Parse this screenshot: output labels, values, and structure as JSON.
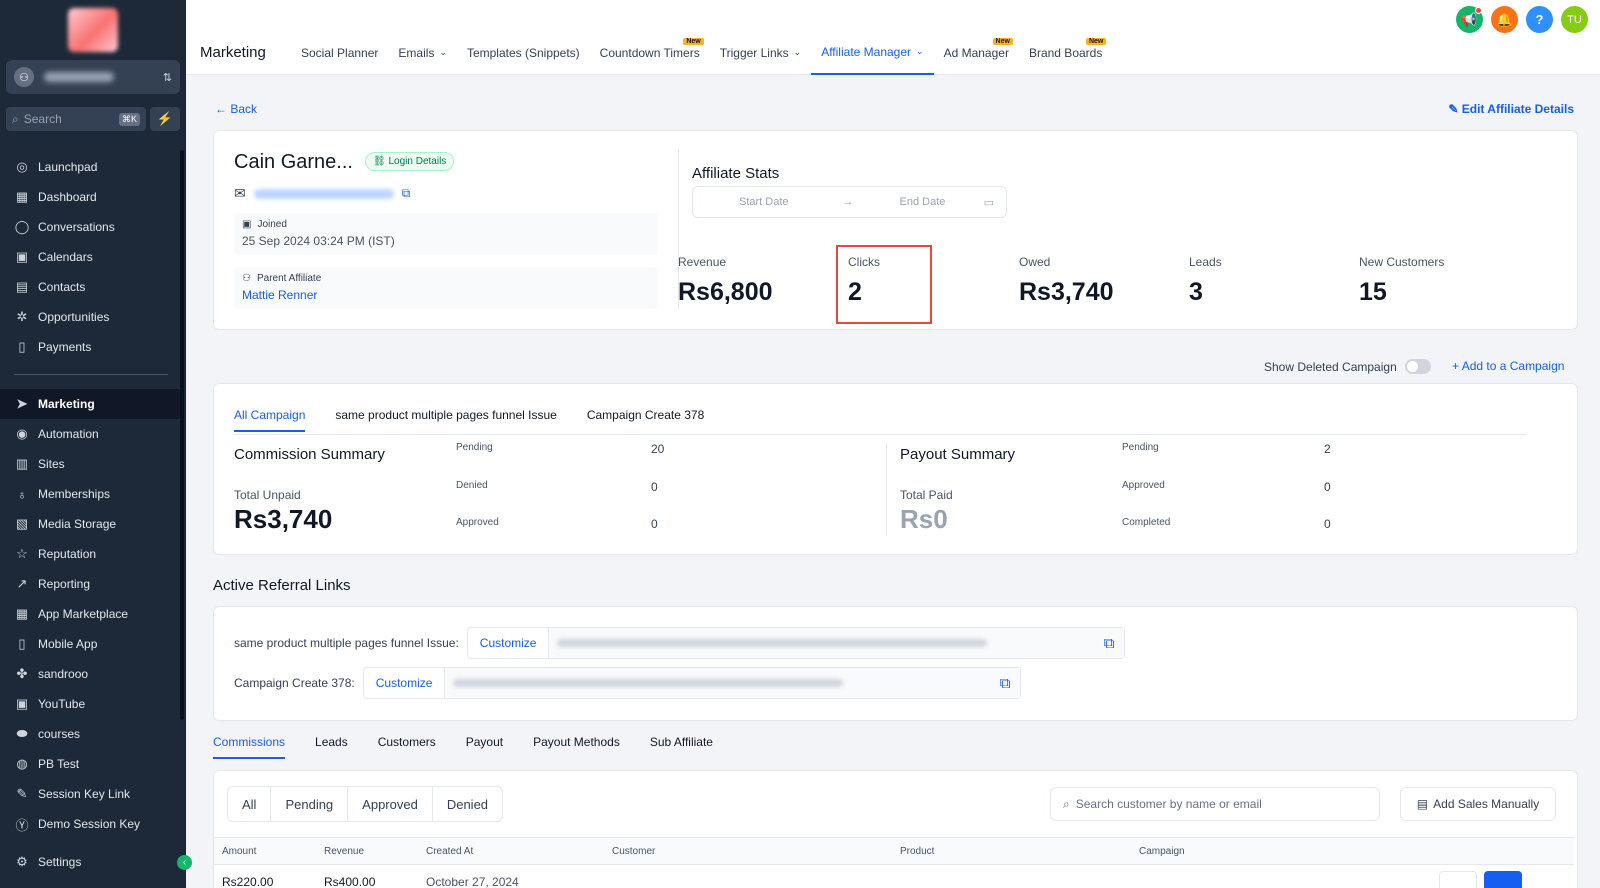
{
  "sidebar": {
    "search_placeholder": "Search",
    "search_shortcut": "⌘K",
    "items": [
      {
        "label": "Launchpad",
        "icon": "rocket-icon",
        "glyph": "◎"
      },
      {
        "label": "Dashboard",
        "icon": "dashboard-icon",
        "glyph": "▦"
      },
      {
        "label": "Conversations",
        "icon": "chat-icon",
        "glyph": "◯"
      },
      {
        "label": "Calendars",
        "icon": "calendar-icon",
        "glyph": "▣"
      },
      {
        "label": "Contacts",
        "icon": "contacts-icon",
        "glyph": "▤"
      },
      {
        "label": "Opportunities",
        "icon": "opportunities-icon",
        "glyph": "✲"
      },
      {
        "label": "Payments",
        "icon": "payments-icon",
        "glyph": "▯"
      }
    ],
    "items2": [
      {
        "label": "Marketing",
        "icon": "send-icon",
        "glyph": "➤",
        "active": true
      },
      {
        "label": "Automation",
        "icon": "automation-icon",
        "glyph": "◉"
      },
      {
        "label": "Sites",
        "icon": "sites-icon",
        "glyph": "▥"
      },
      {
        "label": "Memberships",
        "icon": "memberships-icon",
        "glyph": "♁"
      },
      {
        "label": "Media Storage",
        "icon": "media-icon",
        "glyph": "▧"
      },
      {
        "label": "Reputation",
        "icon": "star-icon",
        "glyph": "☆"
      },
      {
        "label": "Reporting",
        "icon": "reporting-icon",
        "glyph": "↗"
      },
      {
        "label": "App Marketplace",
        "icon": "marketplace-icon",
        "glyph": "▦"
      },
      {
        "label": "Mobile App",
        "icon": "mobile-icon",
        "glyph": "▯"
      },
      {
        "label": "sandrooo",
        "icon": "link-icon",
        "glyph": "✤"
      },
      {
        "label": "YouTube",
        "icon": "youtube-icon",
        "glyph": "▣"
      },
      {
        "label": "courses",
        "icon": "courses-icon",
        "glyph": "⬬"
      },
      {
        "label": "PB Test",
        "icon": "pbtest-icon",
        "glyph": "◍"
      },
      {
        "label": "Session Key Link",
        "icon": "wrench-icon",
        "glyph": "✎"
      },
      {
        "label": "Demo Session Key",
        "icon": "yahoo-icon",
        "glyph": "Ⓨ"
      }
    ],
    "settings": {
      "label": "Settings",
      "icon": "gear-icon",
      "glyph": "⚙"
    }
  },
  "header": {
    "title": "Marketing",
    "tabs": [
      {
        "label": "Social Planner"
      },
      {
        "label": "Emails",
        "dropdown": true
      },
      {
        "label": "Templates (Snippets)"
      },
      {
        "label": "Countdown Timers",
        "badge": "New"
      },
      {
        "label": "Trigger Links",
        "dropdown": true
      },
      {
        "label": "Affiliate Manager",
        "dropdown": true,
        "active": true
      },
      {
        "label": "Ad Manager",
        "badge": "New"
      },
      {
        "label": "Brand Boards",
        "badge": "New"
      }
    ],
    "avatar": "TU",
    "colors": {
      "megaphone": "#12b76a",
      "bell": "#f97316",
      "help": "#2e90fa",
      "avatar": "#84cc16"
    }
  },
  "back_label": "Back",
  "edit_label": "Edit Affiliate Details",
  "affiliate": {
    "name": "Cain Garne...",
    "login_label": "Login Details",
    "joined_label": "Joined",
    "joined_value": "25 Sep 2024 03:24 PM (IST)",
    "parent_label": "Parent Affiliate",
    "parent_value": "Mattie Renner"
  },
  "stats": {
    "title": "Affiliate Stats",
    "start_placeholder": "Start Date",
    "end_placeholder": "End Date",
    "items": [
      {
        "label": "Revenue",
        "value": "Rs6,800"
      },
      {
        "label": "Clicks",
        "value": "2"
      },
      {
        "label": "Owed",
        "value": "Rs3,740"
      },
      {
        "label": "Leads",
        "value": "3"
      },
      {
        "label": "New Customers",
        "value": "15"
      }
    ]
  },
  "show_deleted_label": "Show Deleted Campaign",
  "add_campaign_label": "Add to a Campaign",
  "campaign_tabs": [
    "All Campaign",
    "same product multiple pages funnel Issue",
    "Campaign Create 378"
  ],
  "commission": {
    "title": "Commission Summary",
    "total_label": "Total Unpaid",
    "total_value": "Rs3,740",
    "rows": [
      {
        "label": "Pending",
        "value": "20"
      },
      {
        "label": "Denied",
        "value": "0"
      },
      {
        "label": "Approved",
        "value": "0"
      }
    ]
  },
  "payout": {
    "title": "Payout Summary",
    "total_label": "Total Paid",
    "total_value": "Rs0",
    "rows": [
      {
        "label": "Pending",
        "value": "2"
      },
      {
        "label": "Approved",
        "value": "0"
      },
      {
        "label": "Completed",
        "value": "0"
      }
    ]
  },
  "referral": {
    "title": "Active Referral Links",
    "links": [
      {
        "label": "same product multiple pages funnel Issue:",
        "button": "Customize"
      },
      {
        "label": "Campaign Create 378:",
        "button": "Customize"
      }
    ]
  },
  "bottom_tabs": [
    "Commissions",
    "Leads",
    "Customers",
    "Payout",
    "Payout Methods",
    "Sub Affiliate"
  ],
  "filters": [
    "All",
    "Pending",
    "Approved",
    "Denied"
  ],
  "table_search_placeholder": "Search customer by name or email",
  "add_sales_label": "Add Sales Manually",
  "table": {
    "columns": [
      "Amount",
      "Revenue",
      "Created At",
      "Customer",
      "Product",
      "Campaign"
    ],
    "rows": [
      {
        "amount": "Rs220.00",
        "revenue": "Rs400.00",
        "created": "October 27, 2024"
      }
    ]
  }
}
